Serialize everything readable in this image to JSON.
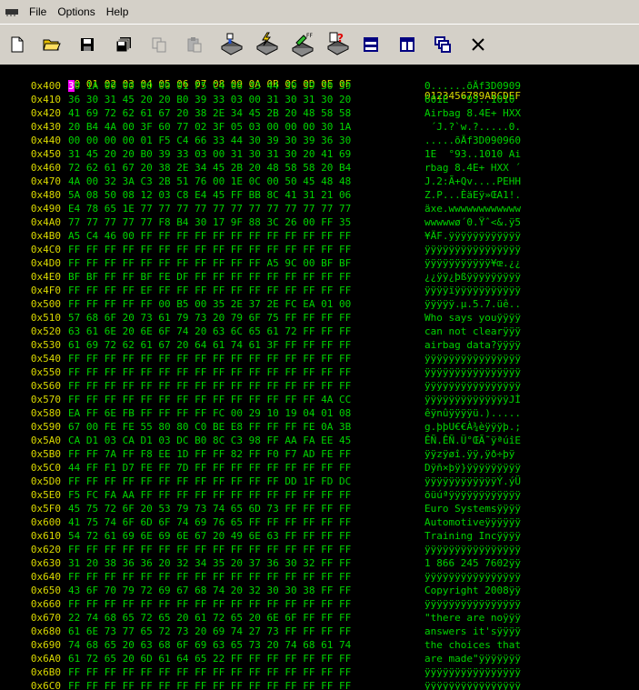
{
  "menu": {
    "file": "File",
    "options": "Options",
    "help": "Help"
  },
  "toolbar": [
    "new-file-icon",
    "open-folder-icon",
    "save-icon",
    "save-all-icon",
    "copy-icon",
    "paste-icon",
    "read-chip-icon",
    "erase-chip-icon",
    "blank-check-chip-icon",
    "verify-chip-icon",
    "horizontal-split-icon",
    "vertical-split-icon",
    "cascade-windows-icon",
    "close-icon"
  ],
  "header": {
    "columns": "00 01 02 03 04 05 06 07 08 09 0A 0B 0C 0D 0E 0F",
    "ascii": "0123456789ABCDEF"
  },
  "rows": [
    {
      "a": "0x400",
      "h": "30 1A 00 00 00 00 01 F5 C4 66 33 44 30 39 30 39",
      "t": "0......õÄf3D0909"
    },
    {
      "a": "0x410",
      "h": "36 30 31 45 20 20 B0 39 33 03 00 31 30 31 30 20",
      "t": "601E  °93..1010 "
    },
    {
      "a": "0x420",
      "h": "41 69 72 62 61 67 20 38 2E 34 45 2B 20 48 58 58",
      "t": "Airbag 8.4E+ HXX"
    },
    {
      "a": "0x430",
      "h": "20 B4 4A 00 3F 60 77 02 3F 05 03 00 00 00 30 1A",
      "t": " ´J.?`w.?.....0."
    },
    {
      "a": "0x440",
      "h": "00 00 00 00 01 F5 C4 66 33 44 30 39 30 39 36 30",
      "t": ".....õÄf3D090960"
    },
    {
      "a": "0x450",
      "h": "31 45 20 20 B0 39 33 03 00 31 30 31 30 20 41 69",
      "t": "1E  °93..1010 Ai"
    },
    {
      "a": "0x460",
      "h": "72 62 61 67 20 38 2E 34 45 2B 20 48 58 58 20 B4",
      "t": "rbag 8.4E+ HXX ´"
    },
    {
      "a": "0x470",
      "h": "4A 00 32 3A C3 2B 51 76 00 1E 0C 00 50 45 48 48",
      "t": "J.2:Ã+Qv....PEHH"
    },
    {
      "a": "0x480",
      "h": "5A 08 50 08 12 03 C8 E4 45 FF BB 8C 41 31 21 06",
      "t": "Z.P...ÈäEÿ»ŒA1!."
    },
    {
      "a": "0x490",
      "h": "E4 78 65 1E 77 77 77 77 77 77 77 77 77 77 77 77",
      "t": "äxe.wwwwwwwwwwww"
    },
    {
      "a": "0x4A0",
      "h": "77 77 77 77 77 F8 B4 30 17 9F 88 3C 26 00 FF 35",
      "t": "wwwwwø´0.Ÿˆ<&.ÿ5"
    },
    {
      "a": "0x4B0",
      "h": "A5 C4 46 00 FF FF FF FF FF FF FF FF FF FF FF FF",
      "t": "¥ÄF.ÿÿÿÿÿÿÿÿÿÿÿÿ"
    },
    {
      "a": "0x4C0",
      "h": "FF FF FF FF FF FF FF FF FF FF FF FF FF FF FF FF",
      "t": "ÿÿÿÿÿÿÿÿÿÿÿÿÿÿÿÿ"
    },
    {
      "a": "0x4D0",
      "h": "FF FF FF FF FF FF FF FF FF FF FF A5 9C 00 BF BF",
      "t": "ÿÿÿÿÿÿÿÿÿÿÿ¥œ.¿¿"
    },
    {
      "a": "0x4E0",
      "h": "BF BF FF FF BF FE DF FF FF FF FF FF FF FF FF FF",
      "t": "¿¿ÿÿ¿þßÿÿÿÿÿÿÿÿÿ"
    },
    {
      "a": "0x4F0",
      "h": "FF FF FF FF EF FF FF FF FF FF FF FF FF FF FF FF",
      "t": "ÿÿÿÿïÿÿÿÿÿÿÿÿÿÿÿ"
    },
    {
      "a": "0x500",
      "h": "FF FF FF FF FF 00 B5 00 35 2E 37 2E FC EA 01 00",
      "t": "ÿÿÿÿÿ.µ.5.7.üê.."
    },
    {
      "a": "0x510",
      "h": "57 68 6F 20 73 61 79 73 20 79 6F 75 FF FF FF FF",
      "t": "Who says youÿÿÿÿ"
    },
    {
      "a": "0x520",
      "h": "63 61 6E 20 6E 6F 74 20 63 6C 65 61 72 FF FF FF",
      "t": "can not clearÿÿÿ"
    },
    {
      "a": "0x530",
      "h": "61 69 72 62 61 67 20 64 61 74 61 3F FF FF FF FF",
      "t": "airbag data?ÿÿÿÿ"
    },
    {
      "a": "0x540",
      "h": "FF FF FF FF FF FF FF FF FF FF FF FF FF FF FF FF",
      "t": "ÿÿÿÿÿÿÿÿÿÿÿÿÿÿÿÿ"
    },
    {
      "a": "0x550",
      "h": "FF FF FF FF FF FF FF FF FF FF FF FF FF FF FF FF",
      "t": "ÿÿÿÿÿÿÿÿÿÿÿÿÿÿÿÿ"
    },
    {
      "a": "0x560",
      "h": "FF FF FF FF FF FF FF FF FF FF FF FF FF FF FF FF",
      "t": "ÿÿÿÿÿÿÿÿÿÿÿÿÿÿÿÿ"
    },
    {
      "a": "0x570",
      "h": "FF FF FF FF FF FF FF FF FF FF FF FF FF FF 4A CC",
      "t": "ÿÿÿÿÿÿÿÿÿÿÿÿÿÿJÌ"
    },
    {
      "a": "0x580",
      "h": "EA FF 6E FB FF FF FF FF FC 00 29 10 19 04 01 08",
      "t": "êÿnûÿÿÿÿü.)....."
    },
    {
      "a": "0x590",
      "h": "67 00 FE FE 55 80 80 C0 BE E8 FF FF FF FE 0A 3B",
      "t": "g.þþU€€À¾èÿÿÿþ.;"
    },
    {
      "a": "0x5A0",
      "h": "CA D1 03 CA D1 03 DC B0 8C C3 98 FF AA FA EE 45",
      "t": "ÊÑ.ÊÑ.Ü°ŒÃ˜ÿªúîE"
    },
    {
      "a": "0x5B0",
      "h": "FF FF 7A FF F8 EE 1D FF FF 82 FF F0 F7 AD FE FF",
      "t": "ÿÿzÿøî.ÿÿ‚ÿð÷­þÿ"
    },
    {
      "a": "0x5C0",
      "h": "44 FF F1 D7 FE FF 7D FF FF FF FF FF FF FF FF FF",
      "t": "Dÿñ×þÿ}ÿÿÿÿÿÿÿÿÿ"
    },
    {
      "a": "0x5D0",
      "h": "FF FF FF FF FF FF FF FF FF FF FF FF DD 1F FD DC",
      "t": "ÿÿÿÿÿÿÿÿÿÿÿÿÝ.ýÜ"
    },
    {
      "a": "0x5E0",
      "h": "F5 FC FA AA FF FF FF FF FF FF FF FF FF FF FF FF",
      "t": "õüúªÿÿÿÿÿÿÿÿÿÿÿÿ"
    },
    {
      "a": "0x5F0",
      "h": "45 75 72 6F 20 53 79 73 74 65 6D 73 FF FF FF FF",
      "t": "Euro Systemsÿÿÿÿ"
    },
    {
      "a": "0x600",
      "h": "41 75 74 6F 6D 6F 74 69 76 65 FF FF FF FF FF FF",
      "t": "Automotiveÿÿÿÿÿÿ"
    },
    {
      "a": "0x610",
      "h": "54 72 61 69 6E 69 6E 67 20 49 6E 63 FF FF FF FF",
      "t": "Training Incÿÿÿÿ"
    },
    {
      "a": "0x620",
      "h": "FF FF FF FF FF FF FF FF FF FF FF FF FF FF FF FF",
      "t": "ÿÿÿÿÿÿÿÿÿÿÿÿÿÿÿÿ"
    },
    {
      "a": "0x630",
      "h": "31 20 38 36 36 20 32 34 35 20 37 36 30 32 FF FF",
      "t": "1 866 245 7602ÿÿ"
    },
    {
      "a": "0x640",
      "h": "FF FF FF FF FF FF FF FF FF FF FF FF FF FF FF FF",
      "t": "ÿÿÿÿÿÿÿÿÿÿÿÿÿÿÿÿ"
    },
    {
      "a": "0x650",
      "h": "43 6F 70 79 72 69 67 68 74 20 32 30 30 38 FF FF",
      "t": "Copyright 2008ÿÿ"
    },
    {
      "a": "0x660",
      "h": "FF FF FF FF FF FF FF FF FF FF FF FF FF FF FF FF",
      "t": "ÿÿÿÿÿÿÿÿÿÿÿÿÿÿÿÿ"
    },
    {
      "a": "0x670",
      "h": "22 74 68 65 72 65 20 61 72 65 20 6E 6F FF FF FF",
      "t": "\"there are noÿÿÿ"
    },
    {
      "a": "0x680",
      "h": "61 6E 73 77 65 72 73 20 69 74 27 73 FF FF FF FF",
      "t": "answers it'sÿÿÿÿ"
    },
    {
      "a": "0x690",
      "h": "74 68 65 20 63 68 6F 69 63 65 73 20 74 68 61 74",
      "t": "the choices that"
    },
    {
      "a": "0x6A0",
      "h": "61 72 65 20 6D 61 64 65 22 FF FF FF FF FF FF FF",
      "t": "are made\"ÿÿÿÿÿÿÿ"
    },
    {
      "a": "0x6B0",
      "h": "FF FF FF FF FF FF FF FF FF FF FF FF FF FF FF FF",
      "t": "ÿÿÿÿÿÿÿÿÿÿÿÿÿÿÿÿ"
    },
    {
      "a": "0x6C0",
      "h": "FF FF FF FF FF FF FF FF FF FF FF FF FF FF FF FF",
      "t": "ÿÿÿÿÿÿÿÿÿÿÿÿÿÿÿÿ"
    }
  ],
  "colors": {
    "address": "#d9d900",
    "bytes": "#00d400",
    "cursor": "#ff00ff",
    "background": "#000000"
  }
}
